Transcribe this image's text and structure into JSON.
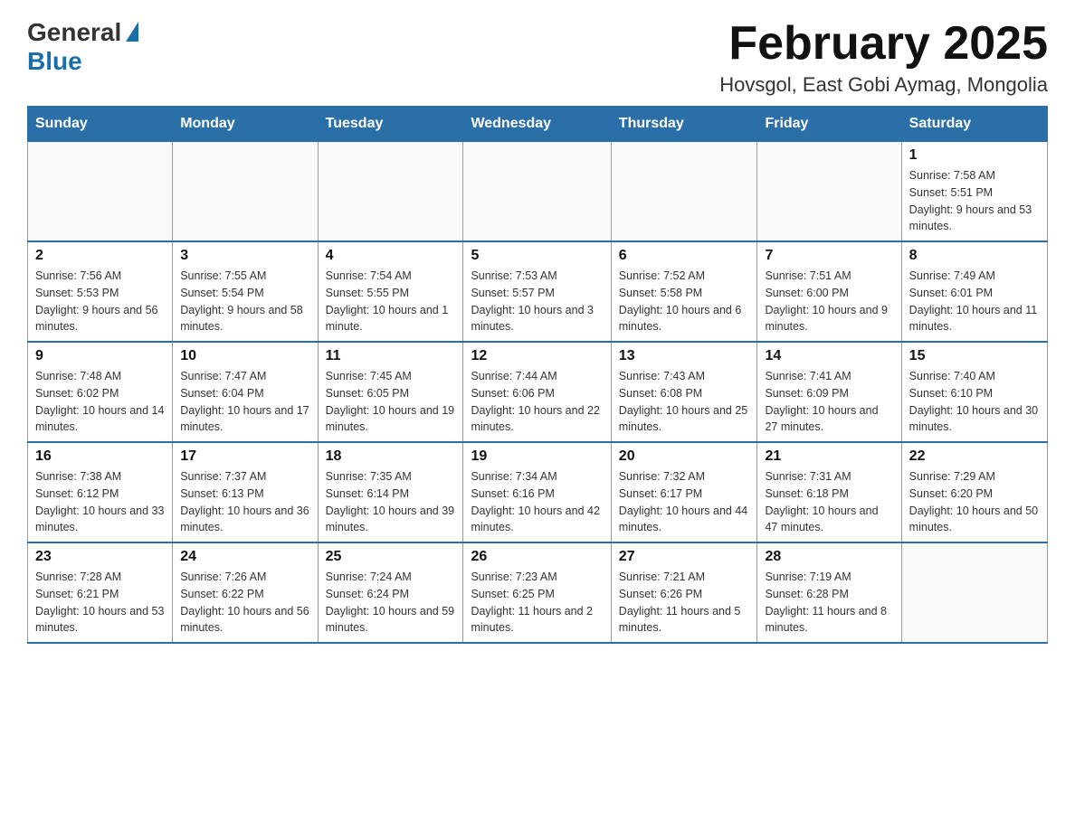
{
  "header": {
    "logo_general": "General",
    "logo_blue": "Blue",
    "month_title": "February 2025",
    "location": "Hovsgol, East Gobi Aymag, Mongolia"
  },
  "days_of_week": [
    "Sunday",
    "Monday",
    "Tuesday",
    "Wednesday",
    "Thursday",
    "Friday",
    "Saturday"
  ],
  "weeks": [
    [
      {
        "day": "",
        "sunrise": "",
        "sunset": "",
        "daylight": ""
      },
      {
        "day": "",
        "sunrise": "",
        "sunset": "",
        "daylight": ""
      },
      {
        "day": "",
        "sunrise": "",
        "sunset": "",
        "daylight": ""
      },
      {
        "day": "",
        "sunrise": "",
        "sunset": "",
        "daylight": ""
      },
      {
        "day": "",
        "sunrise": "",
        "sunset": "",
        "daylight": ""
      },
      {
        "day": "",
        "sunrise": "",
        "sunset": "",
        "daylight": ""
      },
      {
        "day": "1",
        "sunrise": "Sunrise: 7:58 AM",
        "sunset": "Sunset: 5:51 PM",
        "daylight": "Daylight: 9 hours and 53 minutes."
      }
    ],
    [
      {
        "day": "2",
        "sunrise": "Sunrise: 7:56 AM",
        "sunset": "Sunset: 5:53 PM",
        "daylight": "Daylight: 9 hours and 56 minutes."
      },
      {
        "day": "3",
        "sunrise": "Sunrise: 7:55 AM",
        "sunset": "Sunset: 5:54 PM",
        "daylight": "Daylight: 9 hours and 58 minutes."
      },
      {
        "day": "4",
        "sunrise": "Sunrise: 7:54 AM",
        "sunset": "Sunset: 5:55 PM",
        "daylight": "Daylight: 10 hours and 1 minute."
      },
      {
        "day": "5",
        "sunrise": "Sunrise: 7:53 AM",
        "sunset": "Sunset: 5:57 PM",
        "daylight": "Daylight: 10 hours and 3 minutes."
      },
      {
        "day": "6",
        "sunrise": "Sunrise: 7:52 AM",
        "sunset": "Sunset: 5:58 PM",
        "daylight": "Daylight: 10 hours and 6 minutes."
      },
      {
        "day": "7",
        "sunrise": "Sunrise: 7:51 AM",
        "sunset": "Sunset: 6:00 PM",
        "daylight": "Daylight: 10 hours and 9 minutes."
      },
      {
        "day": "8",
        "sunrise": "Sunrise: 7:49 AM",
        "sunset": "Sunset: 6:01 PM",
        "daylight": "Daylight: 10 hours and 11 minutes."
      }
    ],
    [
      {
        "day": "9",
        "sunrise": "Sunrise: 7:48 AM",
        "sunset": "Sunset: 6:02 PM",
        "daylight": "Daylight: 10 hours and 14 minutes."
      },
      {
        "day": "10",
        "sunrise": "Sunrise: 7:47 AM",
        "sunset": "Sunset: 6:04 PM",
        "daylight": "Daylight: 10 hours and 17 minutes."
      },
      {
        "day": "11",
        "sunrise": "Sunrise: 7:45 AM",
        "sunset": "Sunset: 6:05 PM",
        "daylight": "Daylight: 10 hours and 19 minutes."
      },
      {
        "day": "12",
        "sunrise": "Sunrise: 7:44 AM",
        "sunset": "Sunset: 6:06 PM",
        "daylight": "Daylight: 10 hours and 22 minutes."
      },
      {
        "day": "13",
        "sunrise": "Sunrise: 7:43 AM",
        "sunset": "Sunset: 6:08 PM",
        "daylight": "Daylight: 10 hours and 25 minutes."
      },
      {
        "day": "14",
        "sunrise": "Sunrise: 7:41 AM",
        "sunset": "Sunset: 6:09 PM",
        "daylight": "Daylight: 10 hours and 27 minutes."
      },
      {
        "day": "15",
        "sunrise": "Sunrise: 7:40 AM",
        "sunset": "Sunset: 6:10 PM",
        "daylight": "Daylight: 10 hours and 30 minutes."
      }
    ],
    [
      {
        "day": "16",
        "sunrise": "Sunrise: 7:38 AM",
        "sunset": "Sunset: 6:12 PM",
        "daylight": "Daylight: 10 hours and 33 minutes."
      },
      {
        "day": "17",
        "sunrise": "Sunrise: 7:37 AM",
        "sunset": "Sunset: 6:13 PM",
        "daylight": "Daylight: 10 hours and 36 minutes."
      },
      {
        "day": "18",
        "sunrise": "Sunrise: 7:35 AM",
        "sunset": "Sunset: 6:14 PM",
        "daylight": "Daylight: 10 hours and 39 minutes."
      },
      {
        "day": "19",
        "sunrise": "Sunrise: 7:34 AM",
        "sunset": "Sunset: 6:16 PM",
        "daylight": "Daylight: 10 hours and 42 minutes."
      },
      {
        "day": "20",
        "sunrise": "Sunrise: 7:32 AM",
        "sunset": "Sunset: 6:17 PM",
        "daylight": "Daylight: 10 hours and 44 minutes."
      },
      {
        "day": "21",
        "sunrise": "Sunrise: 7:31 AM",
        "sunset": "Sunset: 6:18 PM",
        "daylight": "Daylight: 10 hours and 47 minutes."
      },
      {
        "day": "22",
        "sunrise": "Sunrise: 7:29 AM",
        "sunset": "Sunset: 6:20 PM",
        "daylight": "Daylight: 10 hours and 50 minutes."
      }
    ],
    [
      {
        "day": "23",
        "sunrise": "Sunrise: 7:28 AM",
        "sunset": "Sunset: 6:21 PM",
        "daylight": "Daylight: 10 hours and 53 minutes."
      },
      {
        "day": "24",
        "sunrise": "Sunrise: 7:26 AM",
        "sunset": "Sunset: 6:22 PM",
        "daylight": "Daylight: 10 hours and 56 minutes."
      },
      {
        "day": "25",
        "sunrise": "Sunrise: 7:24 AM",
        "sunset": "Sunset: 6:24 PM",
        "daylight": "Daylight: 10 hours and 59 minutes."
      },
      {
        "day": "26",
        "sunrise": "Sunrise: 7:23 AM",
        "sunset": "Sunset: 6:25 PM",
        "daylight": "Daylight: 11 hours and 2 minutes."
      },
      {
        "day": "27",
        "sunrise": "Sunrise: 7:21 AM",
        "sunset": "Sunset: 6:26 PM",
        "daylight": "Daylight: 11 hours and 5 minutes."
      },
      {
        "day": "28",
        "sunrise": "Sunrise: 7:19 AM",
        "sunset": "Sunset: 6:28 PM",
        "daylight": "Daylight: 11 hours and 8 minutes."
      },
      {
        "day": "",
        "sunrise": "",
        "sunset": "",
        "daylight": ""
      }
    ]
  ]
}
